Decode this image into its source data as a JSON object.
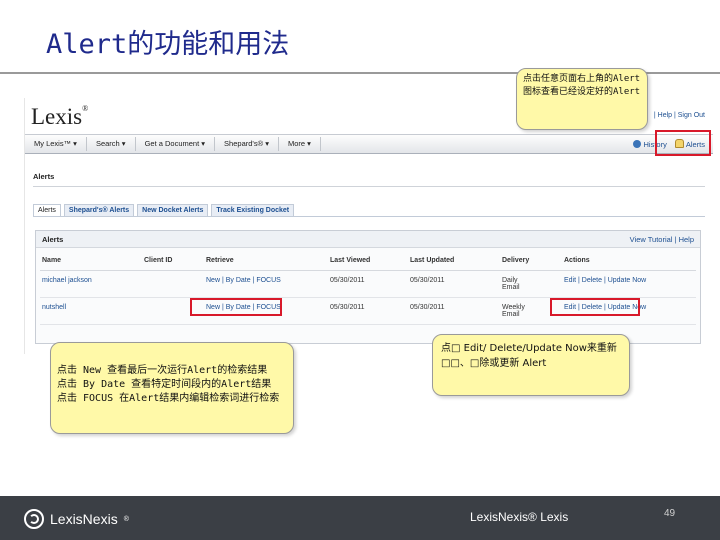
{
  "slide": {
    "title": "Alert的功能和用法",
    "page_number": "49"
  },
  "callouts": {
    "top_right": "点击任意页面右上角的Alert图标查看已经设定好的Alert",
    "left_lines": [
      "点击 New 查看最后一次运行Alert的检索结果",
      "点击 By Date 查看特定时间段内的Alert结果",
      "点击 FOCUS 在Alert结果内编辑检索词进行检索"
    ],
    "right": "点□ Edit/ Delete/Update Now来重新□□、□除或更新 Alert"
  },
  "screenshot": {
    "logo": "Lexis",
    "util_links": "| Help | Sign Out",
    "nav": {
      "items": [
        "My Lexis™",
        "Search",
        "Get a Document",
        "Shepard's®",
        "More"
      ],
      "history": "History",
      "alerts": "Alerts"
    },
    "section_title": "Alerts",
    "tabs": [
      "Alerts",
      "Shepard's® Alerts",
      "New Docket Alerts",
      "Track Existing Docket"
    ],
    "panel": {
      "title": "Alerts",
      "right_links": "View Tutorial | Help"
    },
    "table": {
      "headers": [
        "Name",
        "Client ID",
        "Retrieve",
        "Last Viewed",
        "Last Updated",
        "Delivery",
        "Actions"
      ],
      "rows": [
        {
          "name": "michael jackson",
          "client_id": "",
          "retrieve": "New | By Date | FOCUS",
          "last_viewed": "05/30/2011",
          "last_updated": "05/30/2011",
          "delivery": "Daily",
          "delivery_sub": "Email",
          "actions": "Edit | Delete | Update Now"
        },
        {
          "name": "nutshell",
          "client_id": "",
          "retrieve": "New | By Date | FOCUS",
          "last_viewed": "05/30/2011",
          "last_updated": "05/30/2011",
          "delivery": "Weekly",
          "delivery_sub": "Email",
          "actions": "Edit | Delete | Update Now"
        }
      ]
    }
  },
  "footer": {
    "logo_text": "LexisNexis",
    "center_text": "LexisNexis® Lexis"
  },
  "colors": {
    "title": "#1f2a8c",
    "callout_bg": "#fff9a8",
    "highlight": "#d8192a",
    "footer_bg": "#3b3f45",
    "link": "#1d4f91"
  }
}
